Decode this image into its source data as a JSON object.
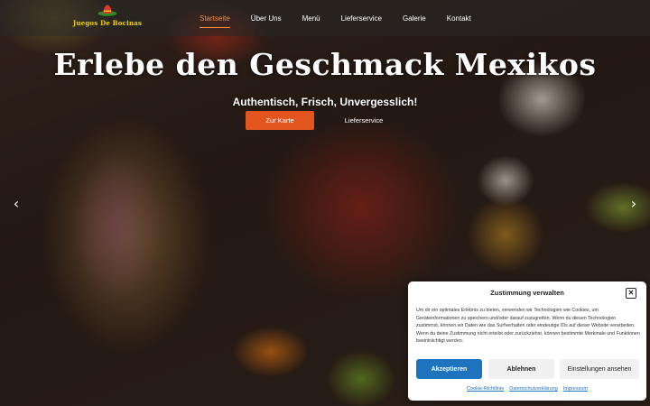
{
  "logo": {
    "text": "Juegos De Bocinas"
  },
  "nav": {
    "items": [
      {
        "label": "Startseite"
      },
      {
        "label": "Über Uns"
      },
      {
        "label": "Menü"
      },
      {
        "label": "Lieferservice"
      },
      {
        "label": "Galerie"
      },
      {
        "label": "Kontakt"
      }
    ],
    "active_index": 0
  },
  "hero": {
    "headline": "Erlebe den Geschmack Mexikos",
    "subline": "Authentisch, Frisch, Unvergesslich!",
    "button_menu": "Zur Karte",
    "button_delivery": "Lieferservice",
    "arrow_left": "‹",
    "arrow_right": "›"
  },
  "consent": {
    "title": "Zustimmung verwalten",
    "close": "✕",
    "body": "Um dir ein optimales Erlebnis zu bieten, verwenden wir Technologien wie Cookies, um Geräteinformationen zu speichern und/oder darauf zuzugreifen. Wenn du diesen Technologien zustimmst, können wir Daten wie das Surfverhalten oder eindeutige IDs auf dieser Website verarbeiten. Wenn du deine Zustimmung nicht erteilst oder zurückziehst, können bestimmte Merkmale und Funktionen beeinträchtigt werden.",
    "accept_label": "Akzeptieren",
    "deny_label": "Ablehnen",
    "prefs_label": "Einstellungen ansehen",
    "links": [
      "Cookie-Richtlinie",
      "Datenschutzerklärung",
      "Impressum"
    ]
  },
  "colors": {
    "accent_orange": "#e2551f",
    "nav_active": "#f08a3e",
    "consent_blue": "#1e73be",
    "logo_yellow": "#f2c21b"
  }
}
